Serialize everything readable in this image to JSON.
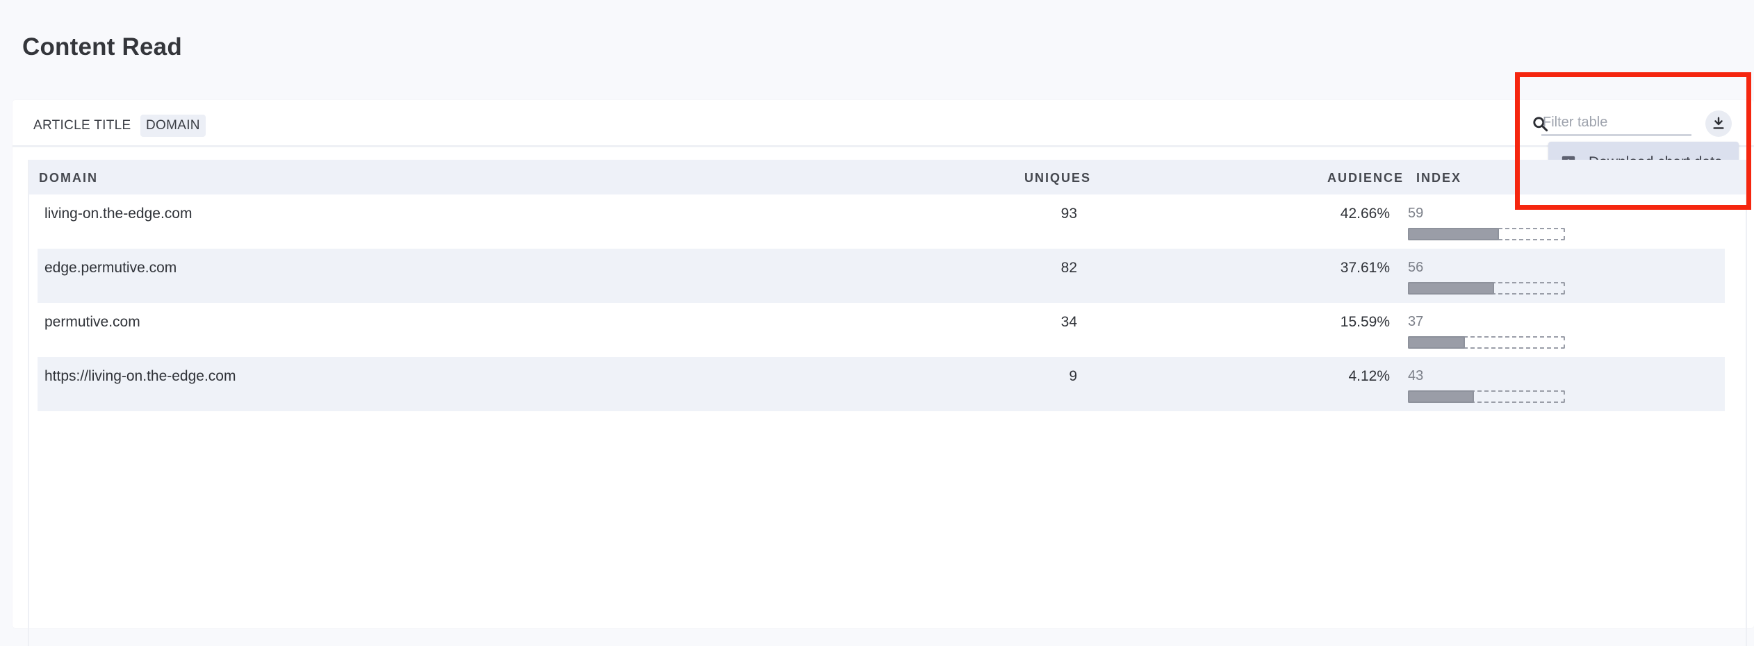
{
  "page": {
    "title": "Content Read"
  },
  "tabs": [
    {
      "label": "ARTICLE TITLE",
      "active": false
    },
    {
      "label": "DOMAIN",
      "active": true
    }
  ],
  "toolbar": {
    "filter_placeholder": "Filter table",
    "download_menu_item": "Download chart data",
    "search_icon": "search-icon",
    "download_icon": "download-icon",
    "chart_icon": "bar-chart-icon"
  },
  "table": {
    "headers": {
      "domain": "DOMAIN",
      "uniques": "UNIQUES",
      "audience": "AUDIENCE",
      "index": "INDEX"
    },
    "rows": [
      {
        "domain": "living-on.the-edge.com",
        "uniques": "93",
        "audience": "42.66%",
        "index": "59",
        "index_fraction": 0.59
      },
      {
        "domain": "edge.permutive.com",
        "uniques": "82",
        "audience": "37.61%",
        "index": "56",
        "index_fraction": 0.56
      },
      {
        "domain": "permutive.com",
        "uniques": "34",
        "audience": "15.59%",
        "index": "37",
        "index_fraction": 0.37
      },
      {
        "domain": "https://living-on.the-edge.com",
        "uniques": "9",
        "audience": "4.12%",
        "index": "43",
        "index_fraction": 0.43
      }
    ]
  },
  "colors": {
    "highlight": "#f5260f",
    "bar_fill": "#9a9da7",
    "row_alt": "#eff2f8"
  }
}
